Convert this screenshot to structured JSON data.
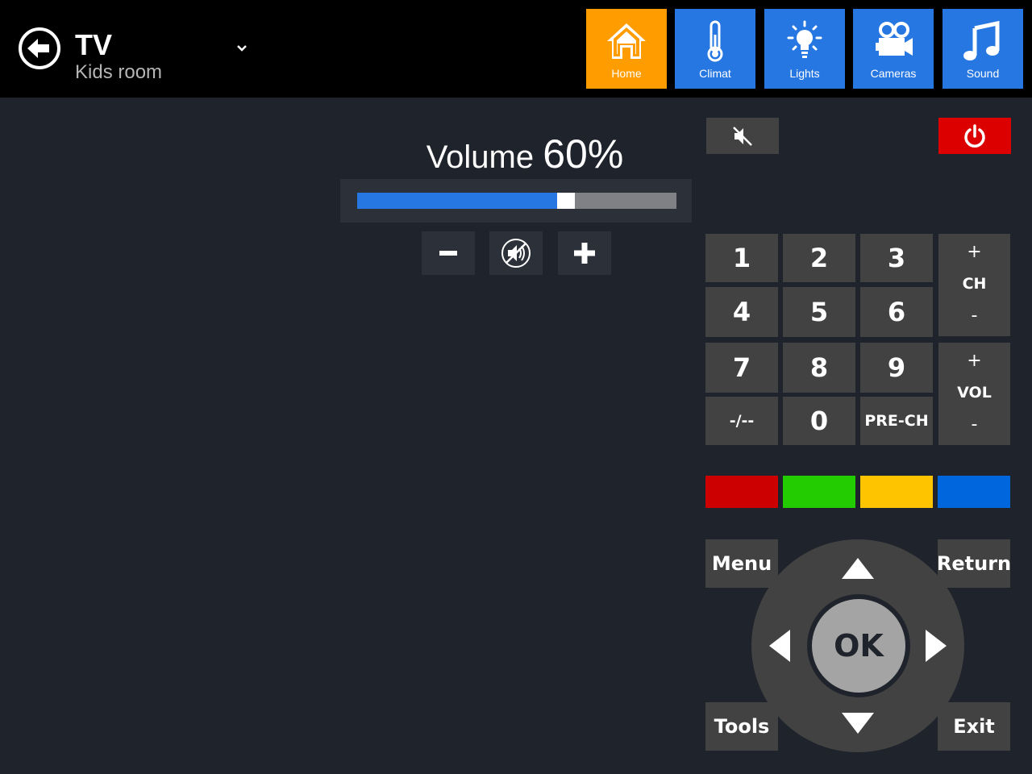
{
  "header": {
    "title": "TV",
    "subtitle": "Kids room"
  },
  "nav": {
    "items": [
      {
        "label": "Home",
        "icon": "home-icon",
        "active": true
      },
      {
        "label": "Climat",
        "icon": "thermometer-icon",
        "active": false
      },
      {
        "label": "Lights",
        "icon": "lightbulb-icon",
        "active": false
      },
      {
        "label": "Cameras",
        "icon": "camera-icon",
        "active": false
      },
      {
        "label": "Sound",
        "icon": "music-note-icon",
        "active": false
      }
    ]
  },
  "volume": {
    "label": "Volume",
    "value_text": "60%",
    "level": 0.6,
    "minus_label": "−",
    "plus_label": "+"
  },
  "remote": {
    "keys": [
      "1",
      "2",
      "3",
      "4",
      "5",
      "6",
      "7",
      "8",
      "9",
      "-/--",
      "0",
      "PRE-CH"
    ],
    "channel": {
      "plus": "+",
      "label": "CH",
      "minus": "-"
    },
    "vol": {
      "plus": "+",
      "label": "VOL",
      "minus": "-"
    },
    "ok_label": "OK",
    "menu_label": "Menu",
    "return_label": "Return",
    "tools_label": "Tools",
    "exit_label": "Exit"
  },
  "colors": {
    "accent": "#2677e2",
    "active_tab": "#ff9d00",
    "power": "#dd0000",
    "key_red": "#cc0000",
    "key_green": "#22cc00",
    "key_yellow": "#ffc400",
    "key_blue": "#0066dd",
    "background": "#1f232b",
    "button": "#424242"
  }
}
